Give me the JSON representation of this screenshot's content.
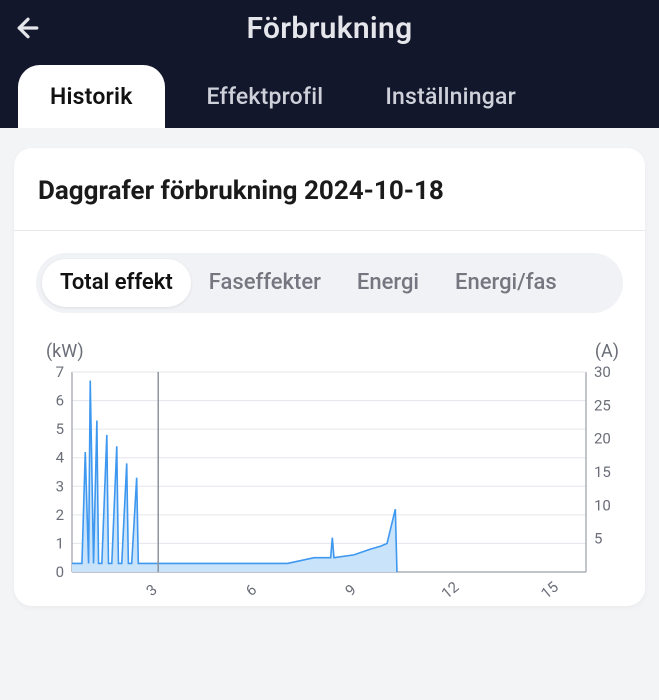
{
  "header": {
    "title": "Förbrukning",
    "tabs": [
      {
        "label": "Historik",
        "active": true
      },
      {
        "label": "Effektprofil",
        "active": false
      },
      {
        "label": "Inställningar",
        "active": false
      }
    ]
  },
  "card": {
    "title": "Daggrafer förbrukning 2024-10-18",
    "segments": [
      {
        "label": "Total effekt",
        "active": true
      },
      {
        "label": "Faseffekter",
        "active": false
      },
      {
        "label": "Energi",
        "active": false
      },
      {
        "label": "Energi/fas",
        "active": false
      }
    ]
  },
  "chart_data": {
    "type": "line",
    "title": "",
    "xlabel": "",
    "ylabel_left": "(kW)",
    "ylabel_right": "(A)",
    "x_ticks": [
      3,
      6,
      9,
      12,
      15
    ],
    "y_ticks_left": [
      0,
      1,
      2,
      3,
      4,
      5,
      6,
      7
    ],
    "y_ticks_right": [
      5,
      10,
      15,
      20,
      25,
      30
    ],
    "xlim": [
      0.5,
      16
    ],
    "ylim_left": [
      0,
      7
    ],
    "ylim_right": [
      0,
      30
    ],
    "cursor_x": 3.1,
    "data_end_x": 10.3,
    "series": [
      {
        "name": "Total effekt",
        "unit": "kW",
        "x": [
          0.5,
          0.8,
          0.9,
          1.0,
          1.05,
          1.15,
          1.25,
          1.3,
          1.4,
          1.55,
          1.6,
          1.7,
          1.85,
          1.9,
          2.0,
          2.15,
          2.2,
          2.3,
          2.45,
          2.5,
          2.6,
          2.7,
          3.0,
          4.0,
          5.0,
          6.0,
          7.0,
          7.8,
          8.0,
          8.3,
          8.35,
          8.4,
          9.0,
          9.5,
          9.8,
          10.0,
          10.25,
          10.3
        ],
        "values": [
          0.3,
          0.3,
          4.2,
          0.3,
          6.7,
          0.3,
          5.3,
          0.3,
          0.3,
          4.8,
          0.3,
          0.3,
          4.4,
          0.3,
          0.3,
          3.8,
          0.3,
          0.3,
          3.3,
          0.3,
          0.3,
          0.3,
          0.3,
          0.3,
          0.3,
          0.3,
          0.3,
          0.5,
          0.5,
          0.5,
          1.2,
          0.5,
          0.6,
          0.8,
          0.9,
          1.0,
          2.2,
          0.0
        ]
      }
    ]
  }
}
